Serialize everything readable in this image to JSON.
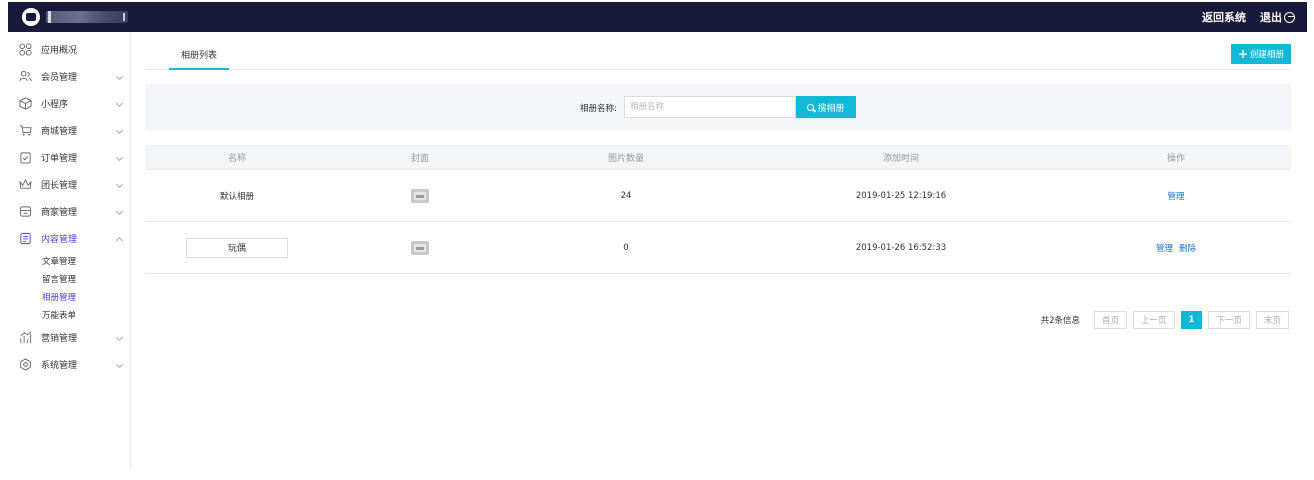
{
  "header": {
    "return_label": "返回系统",
    "logout_label": "退出"
  },
  "sidebar": {
    "items": [
      {
        "label": "应用概况",
        "icon": "grid-icon"
      },
      {
        "label": "会员管理",
        "icon": "users-icon"
      },
      {
        "label": "小程序",
        "icon": "cube-icon"
      },
      {
        "label": "商城管理",
        "icon": "cart-icon"
      },
      {
        "label": "订单管理",
        "icon": "order-icon"
      },
      {
        "label": "团长管理",
        "icon": "crown-icon"
      },
      {
        "label": "商家管理",
        "icon": "shop-icon"
      },
      {
        "label": "内容管理",
        "icon": "content-icon"
      },
      {
        "label": "营销管理",
        "icon": "chart-icon"
      },
      {
        "label": "系统管理",
        "icon": "settings-icon"
      }
    ],
    "content_sub": [
      "文章管理",
      "留言管理",
      "相册管理",
      "万能表单"
    ]
  },
  "tabs": {
    "album_list": "相册列表"
  },
  "create_button": "创建相册",
  "search": {
    "label": "相册名称:",
    "placeholder": "相册名称",
    "button": "搜相册"
  },
  "table": {
    "headers": [
      "名称",
      "封面",
      "图片数量",
      "添加时间",
      "操作"
    ],
    "rows": [
      {
        "name": "默认相册",
        "count": "24",
        "time": "2019-01-25 12:19:16",
        "ops": [
          "管理"
        ]
      },
      {
        "name": "玩偶",
        "count": "0",
        "time": "2019-01-26 16:52:33",
        "ops": [
          "管理",
          "删除"
        ]
      }
    ]
  },
  "pagination": {
    "total": "共2条信息",
    "first": "首页",
    "prev": "上一页",
    "current": "1",
    "next": "下一页",
    "last": "末页"
  },
  "colors": {
    "topbar": "#191a3a",
    "accent": "#10b9d6",
    "active_nav": "#4a3fe0",
    "link": "#1f6fd6"
  }
}
